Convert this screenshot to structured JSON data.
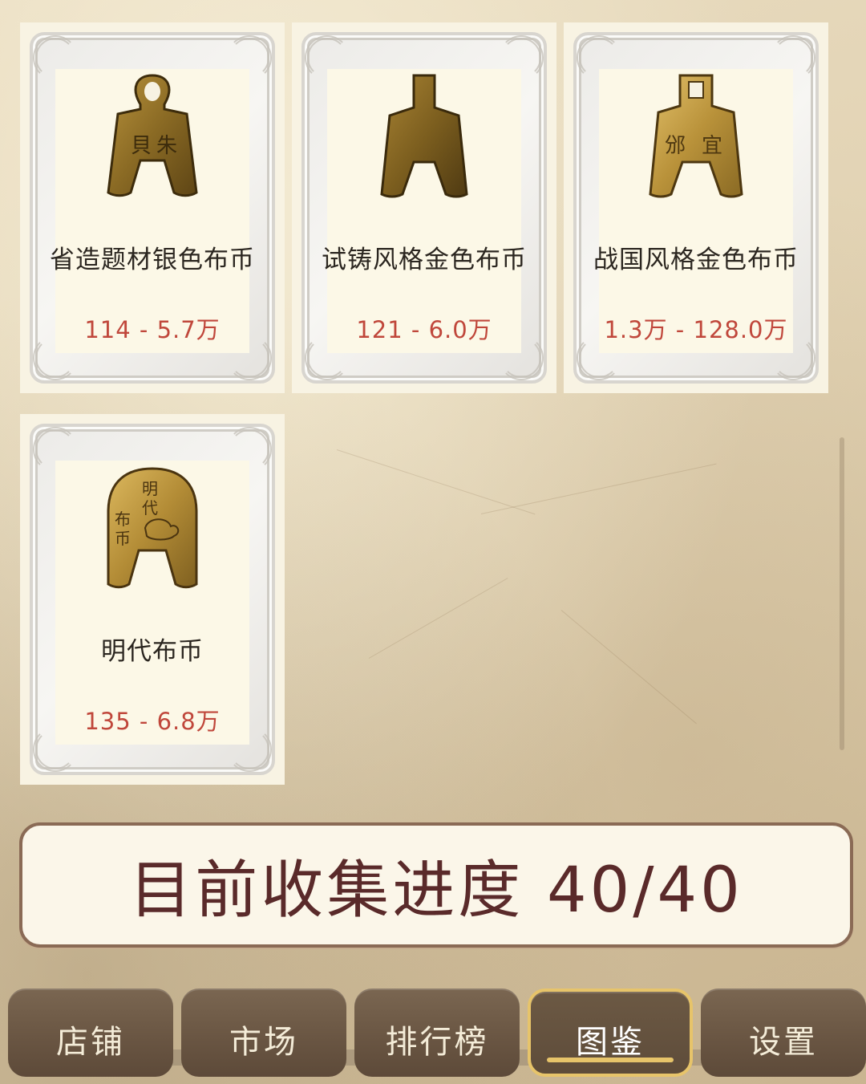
{
  "collection": {
    "items": [
      {
        "name": "省造题材银色布币",
        "price": "114 - 5.7万",
        "coin": "spade-coin-looped-icon"
      },
      {
        "name": "试铸风格金色布币",
        "price": "121 - 6.0万",
        "coin": "spade-coin-plain-icon"
      },
      {
        "name": "战国风格金色布币",
        "price": "1.3万 - 128.0万",
        "coin": "spade-coin-square-hole-icon"
      },
      {
        "name": "明代布币",
        "price": "135 - 6.8万",
        "coin": "spade-coin-ming-icon"
      }
    ]
  },
  "progress": {
    "label": "目前收集进度 40/40"
  },
  "tabs": [
    {
      "label": "店铺"
    },
    {
      "label": "市场"
    },
    {
      "label": "排行榜"
    },
    {
      "label": "图鉴",
      "active": true
    },
    {
      "label": "设置"
    }
  ],
  "colors": {
    "price": "#c0473b",
    "progress_text": "#5a2a2a",
    "tab_bg": "#6a5643",
    "active_border": "#e7c46a"
  }
}
